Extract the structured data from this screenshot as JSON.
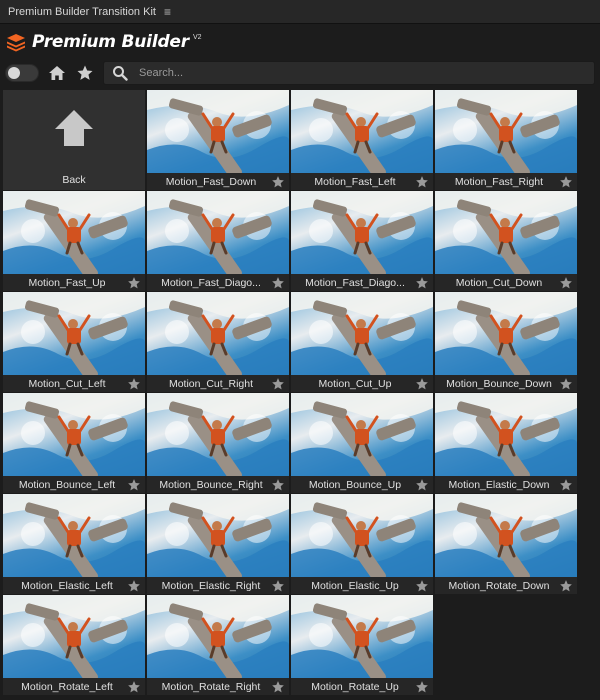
{
  "window": {
    "title": "Premium Builder Transition Kit",
    "menu_icon": "hamburger-icon"
  },
  "brand": {
    "name": "Premium Builder",
    "version": "V2",
    "logo_icon": "layers-logo-icon",
    "accent": "#f26522"
  },
  "toolbar": {
    "toggle_on": false,
    "home_icon": "home-icon",
    "star_icon": "star-icon",
    "search_icon": "search-icon",
    "search_placeholder": "Search...",
    "search_value": ""
  },
  "grid": {
    "back_label": "Back",
    "items": [
      "Motion_Fast_Down",
      "Motion_Fast_Left",
      "Motion_Fast_Right",
      "Motion_Fast_Up",
      "Motion_Fast_Diago...",
      "Motion_Fast_Diago...",
      "Motion_Cut_Down",
      "Motion_Cut_Left",
      "Motion_Cut_Right",
      "Motion_Cut_Up",
      "Motion_Bounce_Down",
      "Motion_Bounce_Left",
      "Motion_Bounce_Right",
      "Motion_Bounce_Up",
      "Motion_Elastic_Down",
      "Motion_Elastic_Left",
      "Motion_Elastic_Right",
      "Motion_Elastic_Up",
      "Motion_Rotate_Down",
      "Motion_Rotate_Left",
      "Motion_Rotate_Right",
      "Motion_Rotate_Up"
    ]
  }
}
